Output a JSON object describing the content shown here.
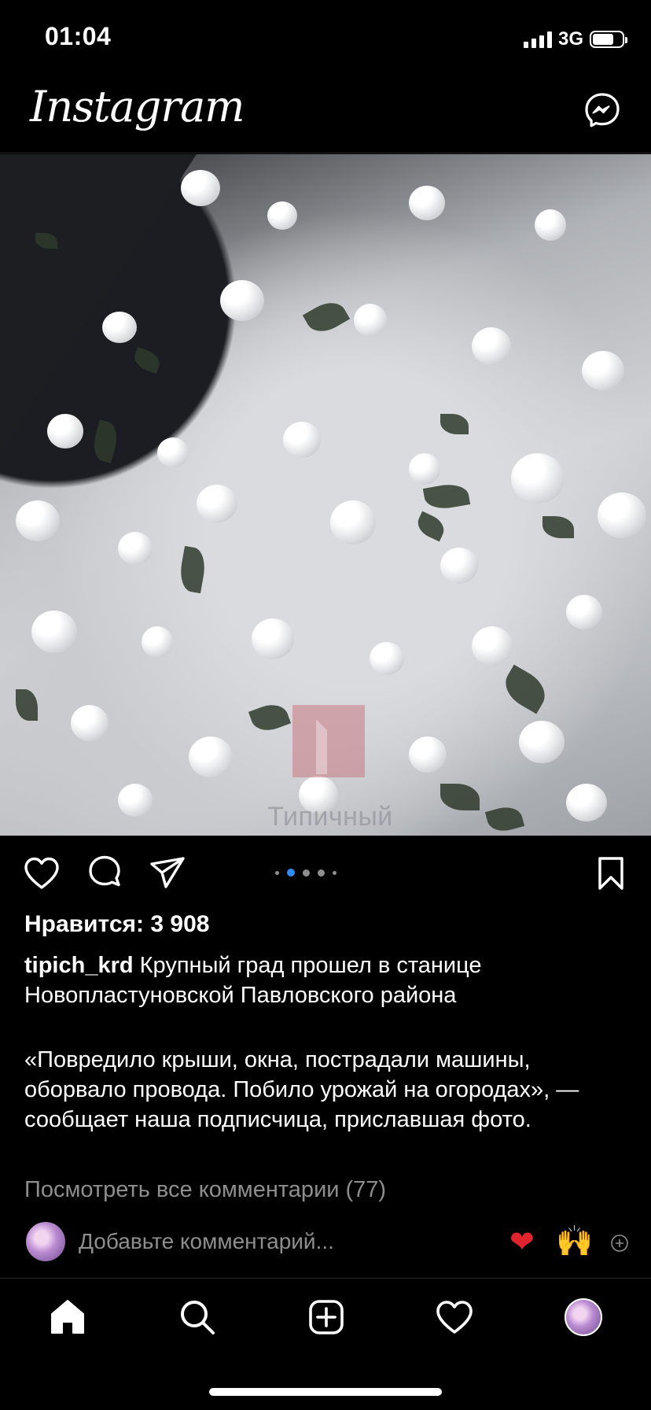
{
  "status_bar": {
    "time": "01:04",
    "network": "3G",
    "signal_bars": 4,
    "battery_level": 0.72
  },
  "header": {
    "app_name": "Instagram",
    "messenger_icon": "messenger-icon"
  },
  "post": {
    "photo": {
      "watermark_text": "Типичный Краснодар"
    },
    "carousel": {
      "total": 5,
      "active_index": 1
    },
    "actions": {
      "like_icon": "heart-outline-icon",
      "comment_icon": "comment-bubble-icon",
      "share_icon": "paper-plane-icon",
      "save_icon": "bookmark-icon"
    },
    "likes_label": "Нравится: 3 908",
    "caption": {
      "username": "tipich_krd",
      "text": "Крупный град прошел в станице Новопластуновской Павловского района",
      "quote": "«Повредило крыши, окна, пострадали машины, оборвало провода. Побило урожай на огородах», — сообщает наша подписчица, приславшая фото."
    },
    "view_comments_label": "Посмотреть все комментарии (77)",
    "comment_input": {
      "placeholder": "Добавьте комментарий...",
      "quick_emojis": [
        "❤",
        "🙌"
      ]
    }
  },
  "bottom_nav": {
    "items": [
      "home-icon",
      "search-icon",
      "create-icon",
      "activity-heart-icon",
      "profile-avatar"
    ]
  }
}
